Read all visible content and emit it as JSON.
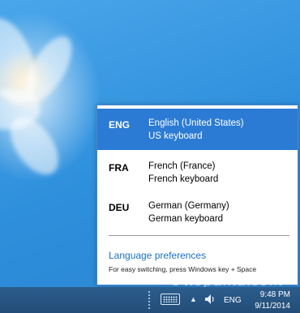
{
  "languages": [
    {
      "code": "ENG",
      "name": "English (United States)",
      "keyboard": "US keyboard",
      "selected": true
    },
    {
      "code": "FRA",
      "name": "French (France)",
      "keyboard": "French keyboard",
      "selected": false
    },
    {
      "code": "DEU",
      "name": "German (Germany)",
      "keyboard": "German keyboard",
      "selected": false
    }
  ],
  "preferences_link": "Language preferences",
  "switch_hint": "For easy switching, press Windows key + Space",
  "taskbar": {
    "language_indicator": "ENG",
    "time": "9:48 PM",
    "date": "9/11/2014",
    "icons": [
      "touch-keyboard-icon",
      "show-hidden-icons-arrow",
      "speaker-icon"
    ]
  },
  "watermark": "Filepuma.com",
  "colors": {
    "selected_row": "#2b7bd4",
    "link": "#1a6fc7",
    "taskbar": "#234d78"
  }
}
